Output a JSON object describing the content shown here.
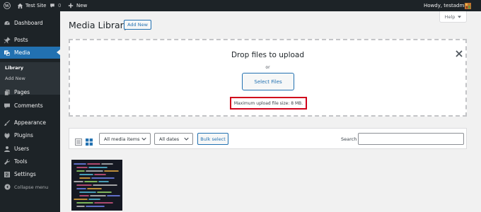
{
  "adminbar": {
    "site_name": "Test Site",
    "comments_count": "0",
    "new_label": "New",
    "greeting": "Howdy, testadmin"
  },
  "sidebar": {
    "items": [
      {
        "label": "Dashboard",
        "icon": "dashboard-icon"
      },
      {
        "label": "Posts",
        "icon": "pin-icon"
      },
      {
        "label": "Media",
        "icon": "media-icon",
        "active": true
      },
      {
        "label": "Pages",
        "icon": "pages-icon"
      },
      {
        "label": "Comments",
        "icon": "comments-icon"
      },
      {
        "label": "Appearance",
        "icon": "brush-icon"
      },
      {
        "label": "Plugins",
        "icon": "plug-icon"
      },
      {
        "label": "Users",
        "icon": "users-icon"
      },
      {
        "label": "Tools",
        "icon": "wrench-icon"
      },
      {
        "label": "Settings",
        "icon": "settings-icon"
      }
    ],
    "submenu": [
      "Library",
      "Add New"
    ],
    "collapse_label": "Collapse menu"
  },
  "main": {
    "title": "Media Library",
    "add_new_label": "Add New",
    "help_label": "Help"
  },
  "upload": {
    "drop_title": "Drop files to upload",
    "or_text": "or",
    "select_files_label": "Select Files",
    "max_upload_text": "Maximum upload file size: 8 MB."
  },
  "toolbar": {
    "media_filter": "All media items",
    "date_filter": "All dates",
    "bulk_select_label": "Bulk select",
    "search_label": "Search",
    "search_value": ""
  },
  "colors": {
    "admin_dark": "#1d2327",
    "accent_blue": "#2271b1",
    "highlight_red": "#d0021b"
  }
}
